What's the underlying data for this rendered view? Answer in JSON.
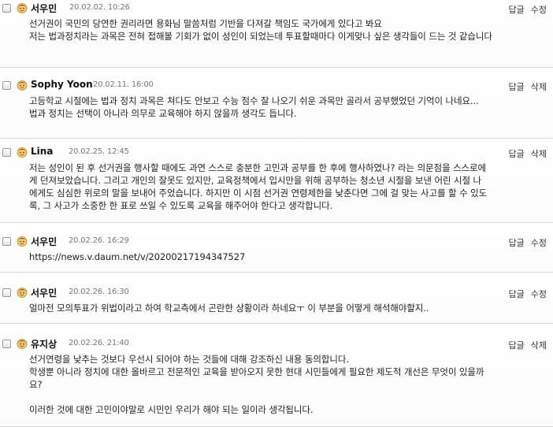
{
  "comments": [
    {
      "author": "서우민",
      "date": "20.02.02. 10:26",
      "actions": [
        "답글",
        "수정"
      ],
      "lines": [
        "선거권이 국민의 당연한 권리라면 용화님 말씀처럼 기반을 다져갈 책임도 국가에게 있다고 봐요",
        "저는 법과정치라는 과목은 전혀 접해볼 기회가 없이 성인이 되었는데 투표할때마다 이게맞나 싶은 생각들이 드는 것 같습니다"
      ]
    },
    {
      "author": "Sophy Yoon",
      "date": "20.02.11. 16:00",
      "actions": [
        "답글",
        "삭제"
      ],
      "lines": [
        "고등학교 시절에는 법과 정치 과목은 쳐다도 안보고 수능 점수 잘 나오기 쉬운 과목만 골라서 공부했었던 기억이 나네요...",
        "법과 정치는 선택이 아니라 의무로 교육해야 하지 않을까 생각도 듭니다."
      ]
    },
    {
      "author": "Lina",
      "date": "20.02.25. 12:45",
      "actions": [
        "답글",
        "삭제"
      ],
      "lines": [
        "저는 성인이 된 후 선거권을 행사할 때에도 과연 스스로 충분한 고민과 공부를 한 후에 행사하였나? 라는 의문점을 스스로에",
        "게 던져보았습니다. 그리고 개인의 잘못도 있지만, 교육정책에서 입시만을 위해 공부하는 청소년 시절을 보낸 어린 시절 나",
        "에게도 심심한 위로의 말을 보내어 주었습니다. 하지만 이 시점 선거권 연령제한을 낮춘다면 그에 걸 맞는 사고를 할 수 있도",
        "록, 그 사고가 소중한 한 표로 쓰일 수 있도록 교육을 해주어야 한다고 생각합니다."
      ]
    },
    {
      "author": "서우민",
      "date": "20.02.26. 16:29",
      "actions": [
        "답글",
        "수정"
      ],
      "lines": [
        "https://news.v.daum.net/v/20200217194347527"
      ]
    },
    {
      "author": "서우민",
      "date": "20.02.26. 16:30",
      "actions": [
        "답글",
        "수정"
      ],
      "lines": [
        "얼마전 모의투표가 위법이라고 하여 학교측에서 곤란한 상황이라 하네요ㅜ 이 부분을 어떻게 해석해야할지.."
      ]
    },
    {
      "author": "유지상",
      "date": "20.02.26. 21:40",
      "actions": [
        "답글",
        "삭제"
      ],
      "lines": [
        "선거연령을 낮추는 것보다 우선시 되어야 하는 것들에 대해 강조하신 내용 동의합니다.",
        "학생뿐 아니라 정치에 대한 올바르고 전문적인 교육을 받아오지 못한 현대 시민들에게 필요한 제도적 개선은 무엇이 있을까",
        "요?",
        "",
        "이러한 것에 대한 고민이야말로 시민인 우리가 해야 되는 일이라 생각됩니다."
      ]
    }
  ]
}
